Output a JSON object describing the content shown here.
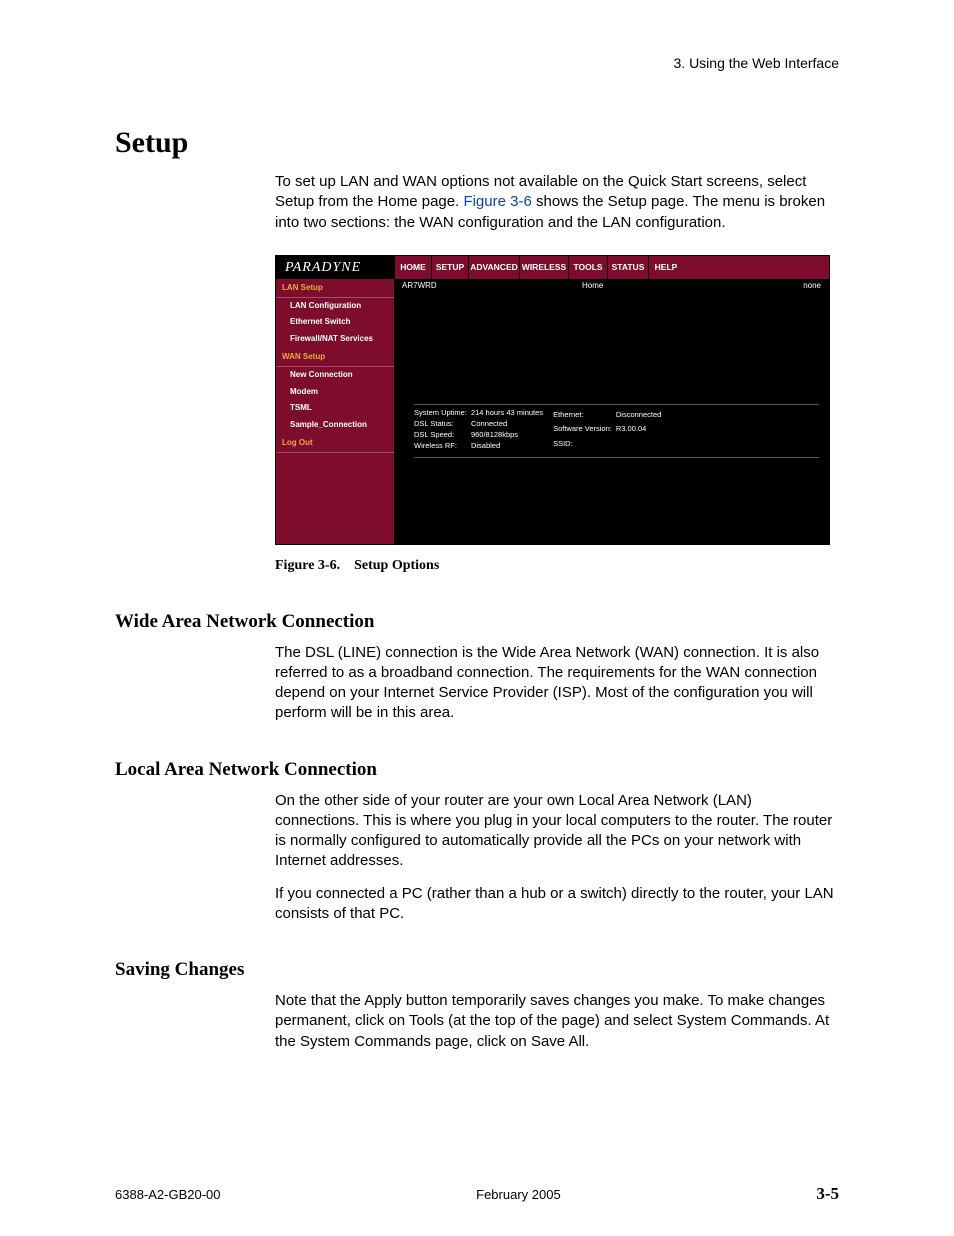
{
  "header_right": "3. Using the Web Interface",
  "h1": "Setup",
  "intro_1_a": "To set up LAN and WAN options not available on the Quick Start screens, select Setup from the Home page. ",
  "intro_1_link": "Figure 3-6",
  "intro_1_b": " shows the Setup page. The menu is broken into two sections: the WAN configuration and the LAN configuration.",
  "shot": {
    "brand": "PARADYNE",
    "tabs": [
      "HOME",
      "SETUP",
      "ADVANCED",
      "WIRELESS",
      "TOOLS",
      "STATUS",
      "HELP"
    ],
    "tabw": [
      36,
      36,
      50,
      48,
      38,
      40,
      34
    ],
    "mainbar_left": "AR7WRD",
    "mainbar_center": "Home",
    "mainbar_right": "none",
    "sidebar": {
      "grp1": "LAN Setup",
      "items1": [
        "LAN Configuration",
        "Ethernet Switch",
        "Firewall/NAT Services"
      ],
      "grp2": "WAN Setup",
      "items2": [
        "New Connection",
        "Modem",
        "TSML",
        "Sample_Connection"
      ],
      "grp3": "Log Out"
    },
    "status_left": [
      [
        "System Uptime:",
        "214 hours 43 minutes"
      ],
      [
        "DSL Status:",
        "Connected"
      ],
      [
        "DSL Speed:",
        "960/8128kbps"
      ],
      [
        "Wireless RF:",
        "Disabled"
      ]
    ],
    "status_right": [
      [
        "Ethernet:",
        "Disconnected"
      ],
      [
        "Software Version:",
        "R3.00.04"
      ],
      [
        "SSID:",
        ""
      ]
    ]
  },
  "caption_a": "Figure 3-6.",
  "caption_b": "Setup Options",
  "wan_h": "Wide Area Network Connection",
  "wan_p": "The DSL (LINE) connection is the Wide Area Network (WAN) connection. It is also referred to as a broadband connection. The requirements for the WAN connection depend on your Internet Service Provider (ISP). Most of the configuration you will perform will be in this area.",
  "lan_h": "Local Area Network Connection",
  "lan_p1": "On the other side of your router are your own Local Area Network (LAN) connections. This is where you plug in your local computers to the router. The router is normally configured to automatically provide all the PCs on your network with Internet addresses.",
  "lan_p2": "If you connected a PC (rather than a hub or a switch) directly to the router, your LAN consists of that PC.",
  "save_h": "Saving Changes",
  "save_p": "Note that the Apply button temporarily saves changes you make. To make changes permanent, click on Tools (at the top of the page) and select System Commands. At the System Commands page, click on Save All.",
  "footer_left": "6388-A2-GB20-00",
  "footer_center": "February 2005",
  "footer_right": "3-5"
}
